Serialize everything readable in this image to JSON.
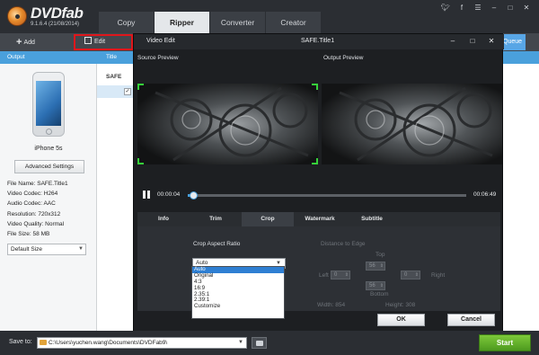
{
  "app": {
    "logo": "DVDfab",
    "version": "9.1.6.4 (21/08/2014)"
  },
  "tabs": [
    {
      "label": "Copy"
    },
    {
      "label": "Ripper"
    },
    {
      "label": "Converter"
    },
    {
      "label": "Creator"
    }
  ],
  "system_icons": [
    "twitter-icon",
    "facebook-icon",
    "menu-icon",
    "minimize-icon",
    "maximize-icon",
    "close-icon"
  ],
  "toolbar": {
    "add_label": "Add",
    "edit_label": "Edit",
    "queue_label": "Queue"
  },
  "left_panel": {
    "header": "Output",
    "device": "iPhone 5s",
    "advanced_settings": "Advanced Settings",
    "file_info": [
      "File Name: SAFE.Title1",
      "Video Codec: H264",
      "Audio Codec: AAC",
      "Resolution: 720x312",
      "Video Quality: Normal",
      "File Size: 58 MB"
    ],
    "size_option": "Default Size"
  },
  "table": {
    "title_header": "Title",
    "row_label": "SAFE"
  },
  "dialog": {
    "title": "Video Edit",
    "file": "SAFE.Title1",
    "source_preview": "Source Preview",
    "output_preview": "Output Preview",
    "time_current": "00:00:04",
    "time_end": "00:06:49",
    "progress": 0.01,
    "edit_tabs": [
      "Info",
      "Trim",
      "Crop",
      "Watermark",
      "Subtitle"
    ],
    "active_tab": "Crop",
    "crop": {
      "aspect_label": "Crop Aspect Ratio",
      "aspect_value": "Auto",
      "aspect_options": [
        "Auto",
        "Original",
        "4:3",
        "16:9",
        "2.35:1",
        "2.39:1",
        "Customize"
      ],
      "distance_label": "Distance to Edge",
      "top_label": "Top",
      "bottom_label": "Bottom",
      "left_label": "Left",
      "right_label": "Right",
      "top_value": "56",
      "bottom_value": "56",
      "left_value": "0",
      "right_value": "0",
      "width_label": "Width: 854",
      "height_label": "Height: 308"
    },
    "ok": "OK",
    "cancel": "Cancel"
  },
  "bottom": {
    "save_to_label": "Save to:",
    "save_path": "C:\\Users\\yuchen.wang\\Documents\\DVDFab9\\",
    "start": "Start"
  },
  "colors": {
    "accent_blue": "#4aa0dc",
    "start_green": "#5aad25",
    "edit_highlight": "#e0161b",
    "crop_marker": "#36d13a"
  }
}
